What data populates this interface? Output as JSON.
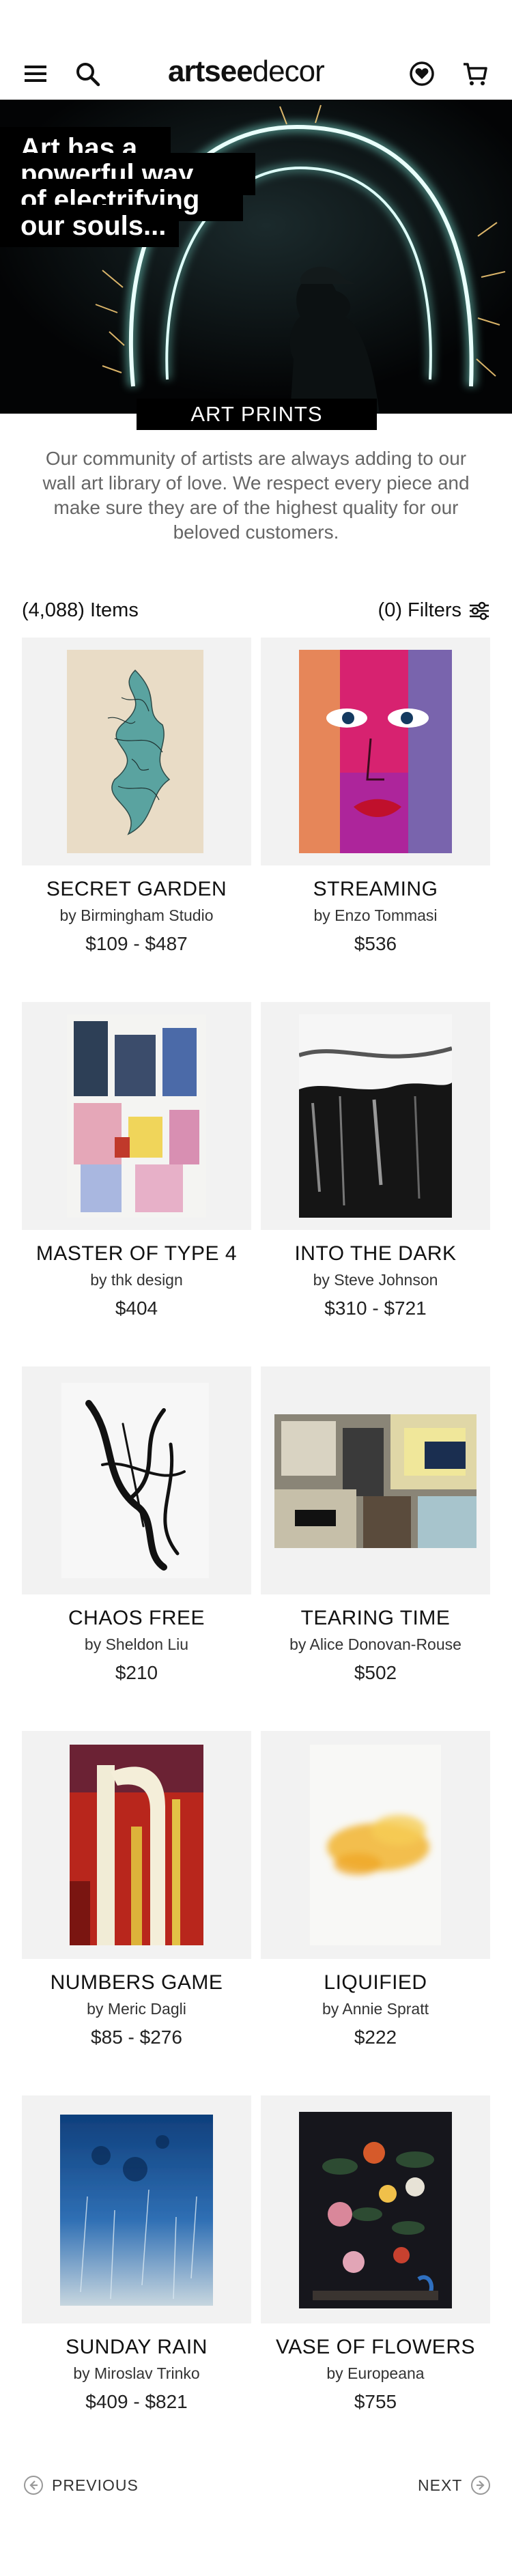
{
  "header": {
    "logo_bold": "artsee",
    "logo_light": "decor",
    "icons": [
      "menu-icon",
      "search-icon",
      "heart-icon",
      "cart-icon"
    ]
  },
  "hero": {
    "lines": [
      "Art has a",
      "powerful way",
      "of electrifying",
      "our souls..."
    ],
    "caption": "ART PRINTS"
  },
  "intro": "Our community of artists are always adding to our wall art library of love. We respect every piece and make sure they are of the highest quality for our beloved customers.",
  "toolbar": {
    "items_label": "(4,088) Items",
    "filters_label": "(0) Filters"
  },
  "products": [
    {
      "title": "SECRET GARDEN",
      "artist": "by Birmingham Studio",
      "price": "$109 - $487"
    },
    {
      "title": "STREAMING",
      "artist": "by Enzo Tommasi",
      "price": "$536"
    },
    {
      "title": "MASTER OF TYPE 4",
      "artist": "by thk design",
      "price": "$404"
    },
    {
      "title": "INTO THE DARK",
      "artist": "by Steve Johnson",
      "price": "$310 - $721"
    },
    {
      "title": "CHAOS FREE",
      "artist": "by Sheldon Liu",
      "price": "$210"
    },
    {
      "title": "TEARING TIME",
      "artist": "by Alice Donovan-Rouse",
      "price": "$502"
    },
    {
      "title": "NUMBERS GAME",
      "artist": "by Meric Dagli",
      "price": "$85 - $276"
    },
    {
      "title": "LIQUIFIED",
      "artist": "by Annie Spratt",
      "price": "$222"
    },
    {
      "title": "SUNDAY RAIN",
      "artist": "by Miroslav Trinko",
      "price": "$409 - $821"
    },
    {
      "title": "VASE OF FLOWERS",
      "artist": "by Europeana",
      "price": "$755"
    }
  ],
  "pagination": {
    "previous": "PREVIOUS",
    "next": "NEXT"
  },
  "colors": {
    "thumb_background": "#f2f2f2",
    "hero_background": "#050608",
    "hero_arc_glow": "#a8f0e6",
    "intro_text": "#666666"
  }
}
